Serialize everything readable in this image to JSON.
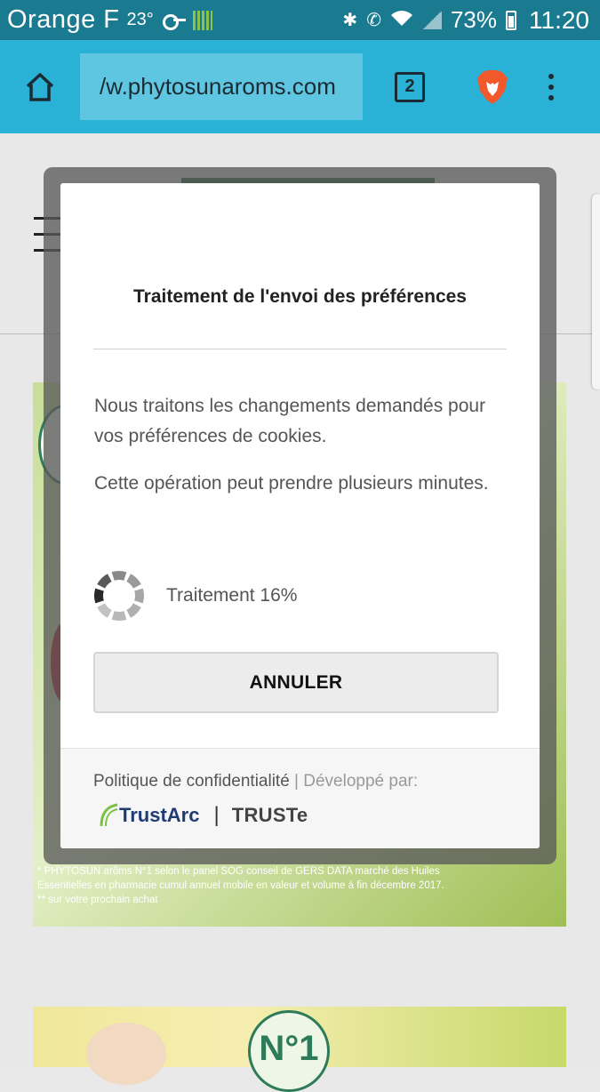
{
  "status_bar": {
    "carrier": "Orange F",
    "temperature": "23°",
    "battery_percent": "73%",
    "time": "11:20"
  },
  "browser": {
    "url_text": "/w.phytosunaroms.com",
    "tab_count": "2"
  },
  "modal": {
    "title": "Traitement de l'envoi des préférences",
    "paragraph_1": "Nous traitons les changements demandés pour vos préférences de cookies.",
    "paragraph_2": "Cette opération peut prendre plusieurs minutes.",
    "progress_text": "Traitement 16%",
    "progress_percent": 16,
    "cancel_label": "ANNULER",
    "footer": {
      "privacy_link": "Politique de confidentialité",
      "separator": " | ",
      "developed_by": "Développé par:",
      "trustarc": "TrustArc",
      "logo_separator": "|",
      "truste": "TRUSTe"
    }
  },
  "background_page": {
    "footnote_line_1": "* PHYTOSUN arôms N°1 selon le panel SOG conseil de GERS DATA marché des Huiles",
    "footnote_line_2": "Essentielles en pharmacie cumul annuel mobile en valeur et volume à fin décembre 2017.",
    "footnote_line_3": "** sur votre prochain achat",
    "badge_text": "N°1"
  },
  "colors": {
    "status_bar": "#1a7a90",
    "toolbar": "#29b2d6",
    "url_box": "#5fc6e1",
    "brave_orange": "#f1582c"
  }
}
